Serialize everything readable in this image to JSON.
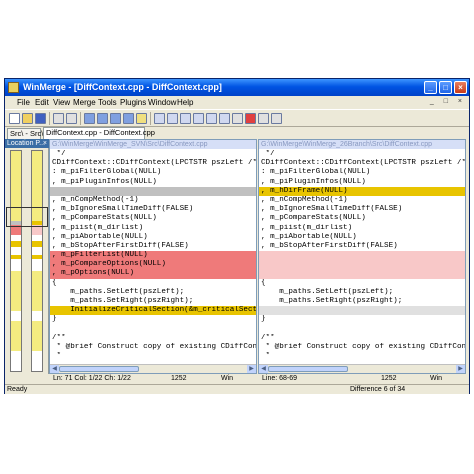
{
  "window": {
    "title": "WinMerge - [DiffContext.cpp - DiffContext.cpp]"
  },
  "caption_buttons": [
    "_",
    "□",
    "×"
  ],
  "menu": [
    "File",
    "Edit",
    "View",
    "Merge",
    "Tools",
    "Plugins",
    "Window",
    "Help"
  ],
  "menu_mdi_icons": "_ □ ×",
  "tabs": [
    "Src\\ - Src\\",
    "DiffContext.cpp - DiffContext.cpp"
  ],
  "location_pane": {
    "label": "Location P...",
    "close": "×"
  },
  "left_pane": {
    "path": "G:\\WinMerge\\WinMerge_SVN\\Src\\DiffContext.cpp",
    "lines": [
      {
        "t": " */",
        "c": ""
      },
      {
        "t": "CDiffContext::CDiffContext(LPCTSTR pszLeft /*=NU",
        "c": ""
      },
      {
        "t": ": m_piFilterGlobal(NULL)",
        "c": ""
      },
      {
        "t": ", m_piPluginInfos(NULL)",
        "c": ""
      },
      {
        "t": "",
        "c": "grey"
      },
      {
        "t": ", m_nCompMethod(-1)",
        "c": ""
      },
      {
        "t": ", m_bIgnoreSmallTimeDiff(FALSE)",
        "c": ""
      },
      {
        "t": ", m_pCompareStats(NULL)",
        "c": ""
      },
      {
        "t": ", m_piist(m_dirlist)",
        "c": ""
      },
      {
        "t": ", m_piAbortable(NULL)",
        "c": ""
      },
      {
        "t": ", m_bStopAfterFirstDiff(FALSE)",
        "c": ""
      },
      {
        "t": ", m_pFilterList(NULL)",
        "c": "red"
      },
      {
        "t": ", m_pCompareOptions(NULL)",
        "c": "red"
      },
      {
        "t": ", m_pOptions(NULL)",
        "c": "red"
      },
      {
        "t": "{",
        "c": ""
      },
      {
        "t": "    m_paths.SetLeft(pszLeft);",
        "c": ""
      },
      {
        "t": "    m_paths.SetRight(pszRight);",
        "c": ""
      },
      {
        "t": "    InitializeCriticalSection(&m_criticalSect);",
        "c": "gold"
      },
      {
        "t": "}",
        "c": ""
      },
      {
        "t": "",
        "c": ""
      },
      {
        "t": "/**",
        "c": ""
      },
      {
        "t": " * @brief Construct copy of existing CDiffContex",
        "c": ""
      },
      {
        "t": " *",
        "c": ""
      }
    ]
  },
  "right_pane": {
    "path": "G:\\WinMerge\\WinMerge_26Branch\\Src\\DiffContext.cpp",
    "lines": [
      {
        "t": " */",
        "c": ""
      },
      {
        "t": "CDiffContext::CDiffContext(LPCTSTR pszLeft /*=NU",
        "c": ""
      },
      {
        "t": ": m_piFilterGlobal(NULL)",
        "c": ""
      },
      {
        "t": ", m_piPluginInfos(NULL)",
        "c": ""
      },
      {
        "t": ", m_hDirFrame(NULL)",
        "c": "gold"
      },
      {
        "t": ", m_nCompMethod(-1)",
        "c": ""
      },
      {
        "t": ", m_bIgnoreSmallTimeDiff(FALSE)",
        "c": ""
      },
      {
        "t": ", m_pCompareStats(NULL)",
        "c": ""
      },
      {
        "t": ", m_piist(m_dirlist)",
        "c": ""
      },
      {
        "t": ", m_piAbortable(NULL)",
        "c": ""
      },
      {
        "t": ", m_bStopAfterFirstDiff(FALSE)",
        "c": ""
      },
      {
        "t": "",
        "c": "pink"
      },
      {
        "t": "",
        "c": "pink"
      },
      {
        "t": "",
        "c": "pink"
      },
      {
        "t": "{",
        "c": ""
      },
      {
        "t": "    m_paths.SetLeft(pszLeft);",
        "c": ""
      },
      {
        "t": "    m_paths.SetRight(pszRight);",
        "c": ""
      },
      {
        "t": "",
        "c": "lgrey"
      },
      {
        "t": "}",
        "c": ""
      },
      {
        "t": "",
        "c": ""
      },
      {
        "t": "/**",
        "c": ""
      },
      {
        "t": " * @brief Construct copy of existing CDiffContex",
        "c": ""
      },
      {
        "t": " *",
        "c": ""
      }
    ]
  },
  "left_status": {
    "pos": "Ln: 71  Col: 1/22  Ch: 1/22",
    "codepage": "1252",
    "eol": "Win"
  },
  "right_status": {
    "pos": "Line: 68-69",
    "codepage": "1252",
    "eol": "Win"
  },
  "statusbar": {
    "ready": "Ready",
    "diff": "Difference 6 of 34"
  }
}
